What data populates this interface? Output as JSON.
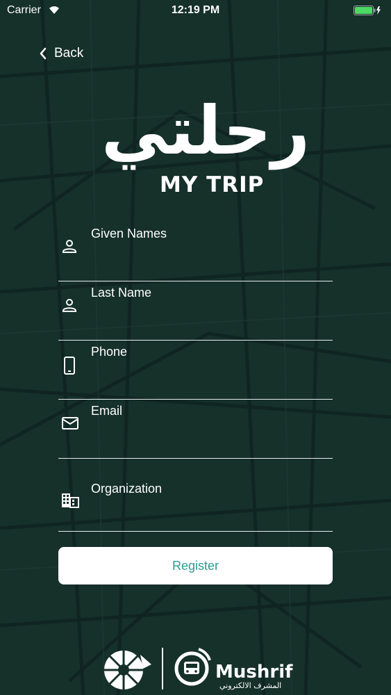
{
  "status_bar": {
    "carrier": "Carrier",
    "time": "12:19 PM",
    "battery_color": "#4cd964"
  },
  "nav": {
    "back_label": "Back"
  },
  "logo": {
    "arabic": "رحلتي",
    "english": "MY TRIP"
  },
  "form": {
    "fields": [
      {
        "label": "Given Names",
        "icon": "person-icon"
      },
      {
        "label": "Last Name",
        "icon": "person-icon"
      },
      {
        "label": "Phone",
        "icon": "phone-icon"
      },
      {
        "label": "Email",
        "icon": "mail-icon"
      },
      {
        "label": "Organization",
        "icon": "building-icon"
      }
    ],
    "register_label": "Register"
  },
  "footer": {
    "brand_name": "Mushrif",
    "brand_arabic": "المشرف الالكتروني"
  },
  "colors": {
    "background": "#16302a",
    "accent": "#2a9d92",
    "text": "#ffffff"
  }
}
